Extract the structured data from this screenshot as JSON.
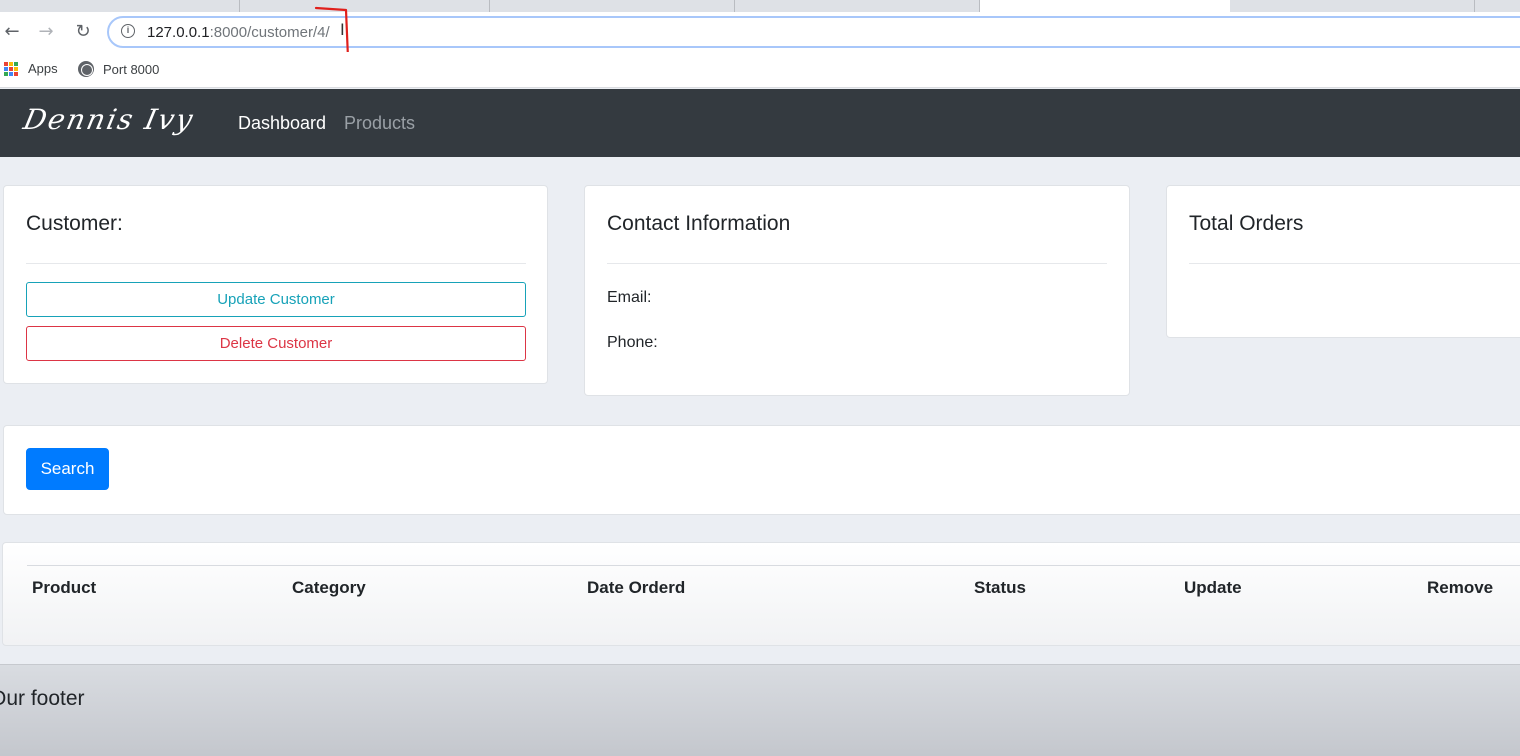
{
  "browser": {
    "url_host": "127.0.0.1",
    "url_path": ":8000/customer/4/",
    "bookmarks": [
      {
        "label": "Apps"
      },
      {
        "label": "Port 8000"
      }
    ]
  },
  "navbar": {
    "brand": "Dennis Ivy",
    "links": [
      {
        "label": "Dashboard"
      },
      {
        "label": "Products"
      }
    ]
  },
  "customer_card": {
    "title": "Customer:",
    "update_button": "Update Customer",
    "delete_button": "Delete Customer"
  },
  "contact_card": {
    "title": "Contact Information",
    "email_label": "Email:",
    "phone_label": "Phone:"
  },
  "orders_card": {
    "title": "Total Orders"
  },
  "search": {
    "button_label": "Search"
  },
  "orders_table": {
    "headers": [
      "Product",
      "Category",
      "Date Orderd",
      "Status",
      "Update",
      "Remove"
    ]
  },
  "footer": {
    "text": "Our footer"
  },
  "colors": {
    "navbar_bg": "#343a40",
    "primary": "#007bff",
    "info": "#17a2b8",
    "danger": "#dc3545"
  }
}
